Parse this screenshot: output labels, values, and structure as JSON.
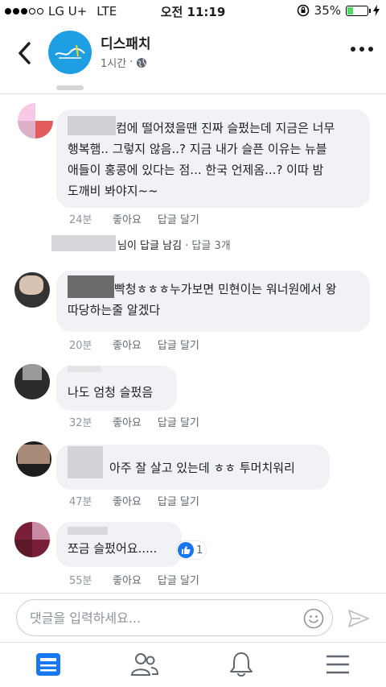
{
  "status_bar": {
    "carrier": "LG U+",
    "network": "LTE",
    "time": "오전 11:19",
    "battery": "35%",
    "battery_level": 0.35
  },
  "header": {
    "page_name": "디스패치",
    "post_time": "1시간"
  },
  "comments": [
    {
      "text": "...컴에 떨어졌을땐 진짜 슬펐는데 지금은 너무 행복햄.. 그렇지 않음..? 지금 내가 슬픈 이유는 뉴블 애들이 홍콩에 있다는 점... 한국 언제옴...? 이따 밤 도깨비 봐야지~~",
      "lines": [
        "컴에 떨어졌을땐 진짜 슬펐는데 지금은 너무",
        "행복햄.. 그렇지 않음..? 지금 내가 슬픈 이유는 뉴블",
        "애들이 홍콩에 있다는 점... 한국 언제옴...? 이따 밤",
        "도깨비 봐야지~~"
      ],
      "time": "24분",
      "like": "좋아요",
      "reply": "답글 달기",
      "reply_summary": {
        "text": "님이 답글 남김",
        "count": "· 답글 3개"
      }
    },
    {
      "lines": [
        "빡청ㅎㅎㅎ누가보면 민현이는 워너원에서 왕",
        "따당하는줄 알겠다"
      ],
      "time": "20분",
      "like": "좋아요",
      "reply": "답글 달기"
    },
    {
      "lines": [
        "나도 엄청 슬펐음"
      ],
      "time": "32분",
      "like": "좋아요",
      "reply": "답글 달기"
    },
    {
      "lines": [
        "아주 잘 살고 있는데 ㅎㅎ 투머치워리"
      ],
      "time": "47분",
      "like": "좋아요",
      "reply": "답글 달기"
    },
    {
      "lines": [
        "쪼금 슬펐어요....."
      ],
      "time": "55분",
      "like": "좋아요",
      "reply": "답글 달기",
      "reaction_count": "1"
    }
  ],
  "composer": {
    "placeholder": "댓글을 입력하세요..."
  },
  "tabs": [
    "news-feed",
    "friends",
    "notifications",
    "menu"
  ],
  "colors": {
    "accent": "#1877f2",
    "bubble": "#f0f2f5",
    "page_avatar": "#1e9ee3"
  }
}
